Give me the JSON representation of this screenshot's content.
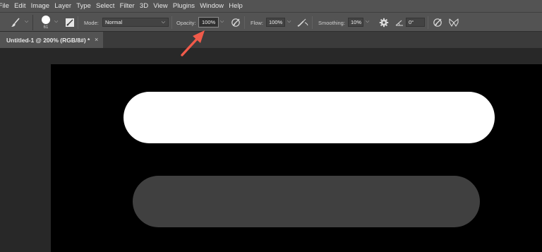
{
  "menubar": {
    "items": [
      "File",
      "Edit",
      "Image",
      "Layer",
      "Type",
      "Select",
      "Filter",
      "3D",
      "View",
      "Plugins",
      "Window",
      "Help"
    ]
  },
  "options": {
    "brush_size": "61",
    "mode_label": "Mode:",
    "mode_value": "Normal",
    "opacity_label": "Opacity:",
    "opacity_value": "100%",
    "flow_label": "Flow:",
    "flow_value": "100%",
    "smoothing_label": "Smoothing:",
    "smoothing_value": "10%",
    "angle_value": "0°"
  },
  "tabs": {
    "document_title": "Untitled-1 @ 200% (RGB/8#) *",
    "close_glyph": "×"
  },
  "canvas": {
    "stroke_colors": [
      "#ffffff",
      "#404040"
    ],
    "background": "#000000"
  },
  "annotation": {
    "arrow_color": "#f05a4a",
    "points_to": "opacity-field"
  },
  "icons": {
    "brush_tool": "brush-icon",
    "toggle_brush_panel": "brush-panel-icon",
    "pressure_opacity": "pressure-opacity-icon",
    "airbrush": "airbrush-icon",
    "smoothing_settings": "gear-icon",
    "angle": "angle-icon",
    "pressure_size": "pressure-size-icon",
    "symmetry": "butterfly-icon"
  }
}
